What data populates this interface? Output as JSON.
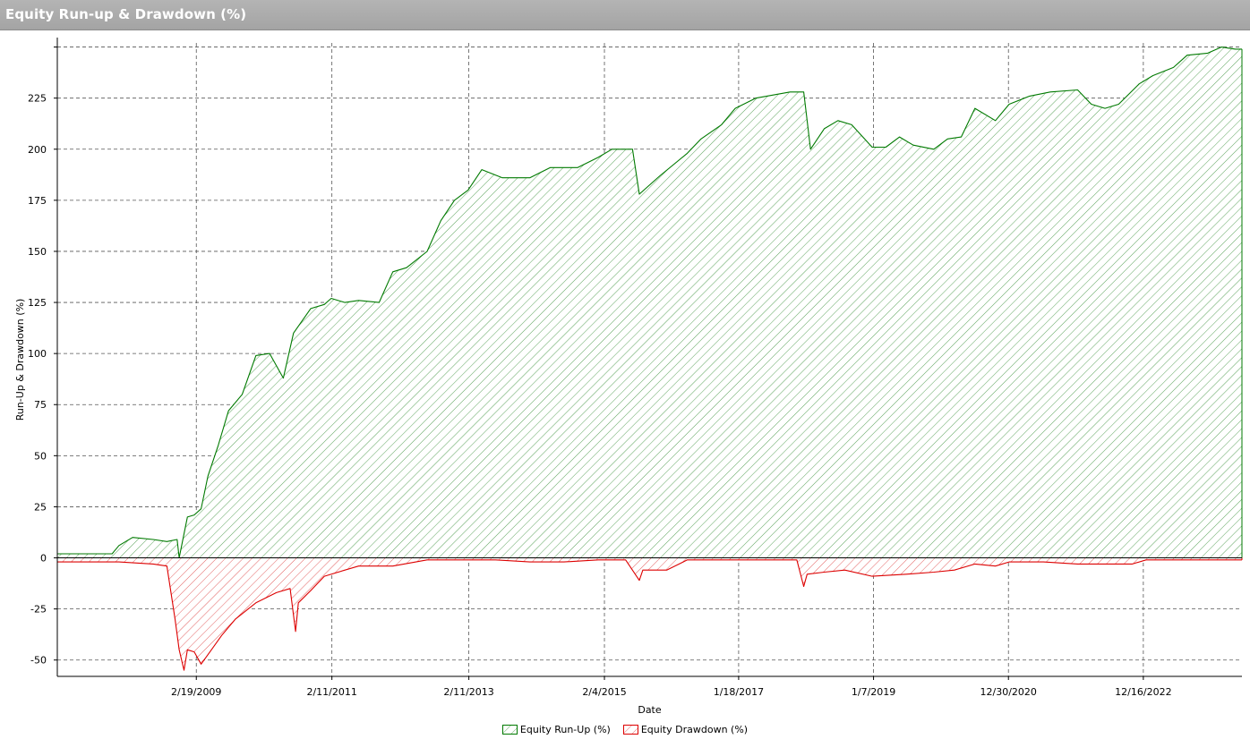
{
  "window": {
    "title": "Equity Run-up & Drawdown (%)"
  },
  "chart_data": {
    "type": "area",
    "xlabel": "Date",
    "ylabel": "Run-Up & Drawdown (%)",
    "ylim": [
      -58,
      252
    ],
    "y_ticks": [
      -50,
      -25,
      0,
      25,
      50,
      75,
      100,
      125,
      150,
      175,
      200,
      225
    ],
    "x_ticks": [
      "2/19/2009",
      "2/11/2011",
      "2/11/2013",
      "2/4/2015",
      "1/18/2017",
      "1/7/2019",
      "12/30/2020",
      "12/16/2022"
    ],
    "x_tick_years": [
      2009.13,
      2011.11,
      2013.11,
      2015.09,
      2017.05,
      2019.02,
      2020.99,
      2022.96
    ],
    "xlim_years": [
      2007.1,
      2024.4
    ],
    "grid": true,
    "legend_position": "bottom-center",
    "colors": {
      "runup": "#007a00",
      "drawdown": "#dd0000",
      "grid": "#555555"
    },
    "series": [
      {
        "name": "Equity Run-Up (%)",
        "x": [
          2007.1,
          2007.5,
          2007.9,
          2008.0,
          2008.2,
          2008.5,
          2008.7,
          2008.85,
          2008.88,
          2009.0,
          2009.1,
          2009.2,
          2009.3,
          2009.45,
          2009.6,
          2009.8,
          2010.0,
          2010.2,
          2010.4,
          2010.55,
          2010.8,
          2011.0,
          2011.1,
          2011.3,
          2011.5,
          2011.8,
          2012.0,
          2012.2,
          2012.5,
          2012.7,
          2012.9,
          2013.1,
          2013.3,
          2013.6,
          2014.0,
          2014.3,
          2014.7,
          2015.0,
          2015.2,
          2015.5,
          2015.6,
          2015.9,
          2016.3,
          2016.5,
          2016.8,
          2017.0,
          2017.3,
          2017.8,
          2018.0,
          2018.1,
          2018.3,
          2018.5,
          2018.7,
          2019.0,
          2019.2,
          2019.4,
          2019.6,
          2019.9,
          2020.1,
          2020.3,
          2020.5,
          2020.8,
          2021.0,
          2021.3,
          2021.6,
          2022.0,
          2022.2,
          2022.4,
          2022.6,
          2022.9,
          2023.1,
          2023.4,
          2023.6,
          2023.9,
          2024.1,
          2024.3,
          2024.4
        ],
        "values": [
          2,
          2,
          2,
          6,
          10,
          9,
          8,
          9,
          0,
          20,
          21,
          24,
          40,
          55,
          72,
          80,
          99,
          100,
          88,
          110,
          122,
          124,
          127,
          125,
          126,
          125,
          140,
          142,
          150,
          165,
          175,
          180,
          190,
          186,
          186,
          191,
          191,
          196,
          200,
          200,
          178,
          187,
          198,
          205,
          212,
          220,
          225,
          228,
          228,
          200,
          210,
          214,
          212,
          201,
          201,
          206,
          202,
          200,
          205,
          206,
          220,
          214,
          222,
          226,
          228,
          229,
          222,
          220,
          222,
          232,
          236,
          240,
          246,
          247,
          250,
          249,
          249
        ]
      },
      {
        "name": "Equity Drawdown (%)",
        "x": [
          2007.1,
          2007.5,
          2008.0,
          2008.5,
          2008.7,
          2008.82,
          2008.88,
          2008.95,
          2009.0,
          2009.1,
          2009.2,
          2009.35,
          2009.5,
          2009.7,
          2010.0,
          2010.3,
          2010.5,
          2010.58,
          2010.62,
          2010.8,
          2011.0,
          2011.3,
          2011.5,
          2012.0,
          2012.5,
          2013.0,
          2013.5,
          2014.0,
          2014.5,
          2015.0,
          2015.4,
          2015.6,
          2015.65,
          2016.0,
          2016.3,
          2016.6,
          2017.0,
          2017.5,
          2017.9,
          2018.0,
          2018.05,
          2018.3,
          2018.6,
          2019.0,
          2019.5,
          2019.9,
          2020.2,
          2020.5,
          2020.8,
          2021.0,
          2021.5,
          2022.0,
          2022.5,
          2022.8,
          2023.0,
          2023.5,
          2024.0,
          2024.4
        ],
        "values": [
          -2,
          -2,
          -2,
          -3,
          -4,
          -30,
          -45,
          -55,
          -45,
          -46,
          -52,
          -45,
          -38,
          -30,
          -22,
          -17,
          -15,
          -36,
          -22,
          -16,
          -9,
          -6,
          -4,
          -4,
          -1,
          -1,
          -1,
          -2,
          -2,
          -1,
          -1,
          -11,
          -6,
          -6,
          -1,
          -1,
          -1,
          -1,
          -1,
          -14,
          -8,
          -7,
          -6,
          -9,
          -8,
          -7,
          -6,
          -3,
          -4,
          -2,
          -2,
          -3,
          -3,
          -3,
          -1,
          -1,
          -1,
          -1
        ]
      }
    ]
  }
}
